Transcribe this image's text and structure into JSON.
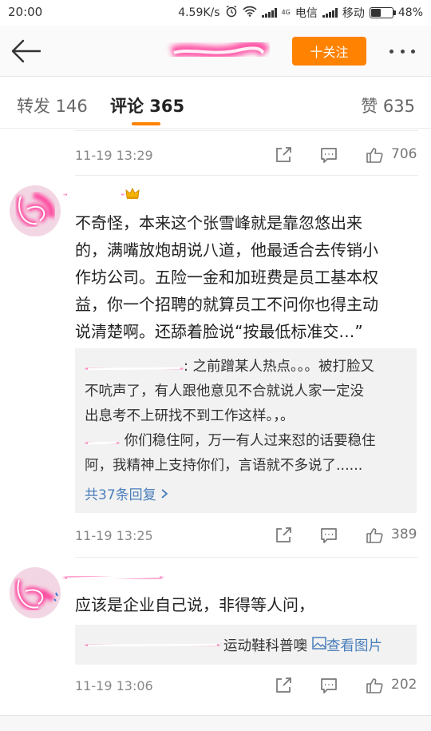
{
  "status_bar": {
    "time": "20:00",
    "speed": "4.59K/s",
    "network_label": "4G",
    "carrier1": "电信",
    "carrier2": "移动",
    "battery": "48%",
    "battery_level": 0.48
  },
  "nav": {
    "follow_label": "十关注"
  },
  "tabs": {
    "repost": "转发 146",
    "comments": "评论 365",
    "likes": "赞 635"
  },
  "comments": [
    {
      "time": "11-19 13:29",
      "likes": "706"
    },
    {
      "text_lines": [
        "不奇怪，本来这个张雪峰就是靠忽悠出来",
        "的，满嘴放炮胡说八道，他最适合去传销小",
        "作坊公司。五险一金和加班费是员工基本权",
        "益，你一个招聘的就算员工不问你也得主动",
        "说清楚啊。还舔着脸说“按最低标准交…”"
      ],
      "replies": [
        {
          "text_first": ": 之前蹭某人热点。。。被打脸又",
          "text_rest": [
            "不吭声了，有人跟他意见不合就说人家一定没",
            "出息考不上研找不到工作这样。，。"
          ]
        },
        {
          "text_first": " 你们稳住阿，万一有人过来怼的话要稳住",
          "text_rest": [
            "阿，我精神上支持你们，言语就不多说了......"
          ]
        }
      ],
      "more_replies": "共37条回复",
      "time": "11-19 13:25",
      "likes": "389"
    },
    {
      "text": "应该是企业自己说，非得等人问，",
      "reply_text": "运动鞋科普噢",
      "reply_link": "查看图片",
      "time": "11-19 13:06",
      "likes": "202"
    }
  ],
  "colors": {
    "accent": "#ff8200",
    "link": "#4a7ebb",
    "redaction": "#ff3d9a"
  }
}
